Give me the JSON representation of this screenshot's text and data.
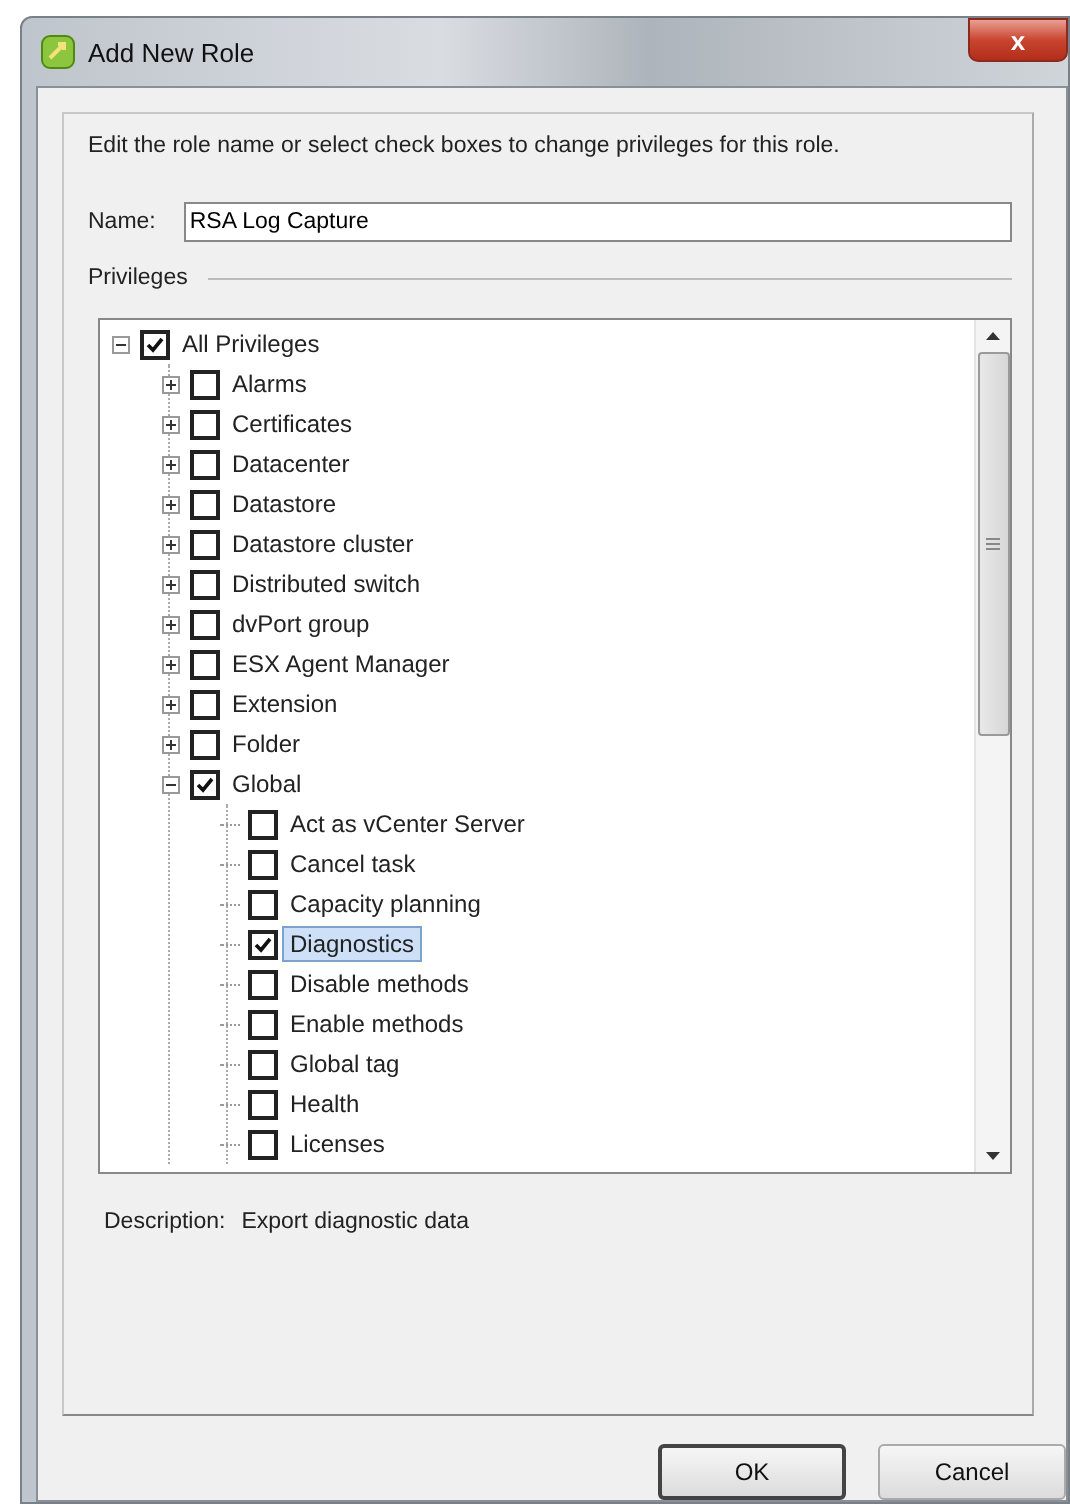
{
  "window": {
    "title": "Add New Role",
    "close": "x"
  },
  "instruction": "Edit the role name or select check boxes to change privileges for this role.",
  "name_field": {
    "label": "Name:",
    "value": "RSA Log Capture"
  },
  "privileges": {
    "label": "Privileges",
    "tree": [
      {
        "label": "All Privileges",
        "checked": true,
        "expanded": true,
        "selected": false,
        "children": [
          {
            "label": "Alarms",
            "checked": false,
            "expanded": false,
            "selected": false
          },
          {
            "label": "Certificates",
            "checked": false,
            "expanded": false,
            "selected": false
          },
          {
            "label": "Datacenter",
            "checked": false,
            "expanded": false,
            "selected": false
          },
          {
            "label": "Datastore",
            "checked": false,
            "expanded": false,
            "selected": false
          },
          {
            "label": "Datastore cluster",
            "checked": false,
            "expanded": false,
            "selected": false
          },
          {
            "label": "Distributed switch",
            "checked": false,
            "expanded": false,
            "selected": false
          },
          {
            "label": "dvPort group",
            "checked": false,
            "expanded": false,
            "selected": false
          },
          {
            "label": "ESX Agent Manager",
            "checked": false,
            "expanded": false,
            "selected": false
          },
          {
            "label": "Extension",
            "checked": false,
            "expanded": false,
            "selected": false
          },
          {
            "label": "Folder",
            "checked": false,
            "expanded": false,
            "selected": false
          },
          {
            "label": "Global",
            "checked": true,
            "expanded": true,
            "selected": false,
            "children": [
              {
                "label": "Act as vCenter Server",
                "checked": false,
                "selected": false
              },
              {
                "label": "Cancel task",
                "checked": false,
                "selected": false
              },
              {
                "label": "Capacity planning",
                "checked": false,
                "selected": false
              },
              {
                "label": "Diagnostics",
                "checked": true,
                "selected": true
              },
              {
                "label": "Disable methods",
                "checked": false,
                "selected": false
              },
              {
                "label": "Enable methods",
                "checked": false,
                "selected": false
              },
              {
                "label": "Global tag",
                "checked": false,
                "selected": false
              },
              {
                "label": "Health",
                "checked": false,
                "selected": false
              },
              {
                "label": "Licenses",
                "checked": false,
                "selected": false
              }
            ]
          }
        ]
      }
    ]
  },
  "description": {
    "label": "Description:",
    "value": "Export diagnostic data"
  },
  "buttons": [
    {
      "label": "OK",
      "default": true
    },
    {
      "label": "Cancel",
      "default": false
    }
  ]
}
